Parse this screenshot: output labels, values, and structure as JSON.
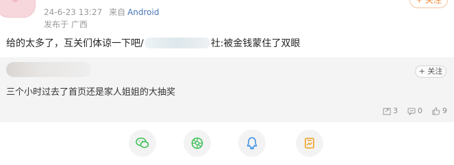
{
  "post": {
    "date": "24-6-23 13:27",
    "source_prefix": "来自",
    "source_platform": "Android",
    "location": "发布于 广西",
    "follow_label": "+ 关注",
    "text_before": "给的太多了，互关们体谅一下吧/",
    "text_after": "社:被金钱蒙住了双眼"
  },
  "repost": {
    "follow_label": "+ 关注",
    "text": "三个小时过去了首页还是家人姐姐的大抽奖",
    "stats": {
      "repost_count": "3",
      "comment_count": "0",
      "like_count": "9"
    }
  },
  "share": {
    "items": [
      {
        "icon": "wechat-icon",
        "color": "#3bbf55"
      },
      {
        "icon": "moments-icon",
        "color": "#3bbf55"
      },
      {
        "icon": "qq-icon",
        "color": "#3a8ee6"
      },
      {
        "icon": "poster-icon",
        "color": "#f0a020"
      }
    ]
  },
  "colors": {
    "accent_orange": "#f28a3a",
    "link_blue": "#4a76b8"
  }
}
